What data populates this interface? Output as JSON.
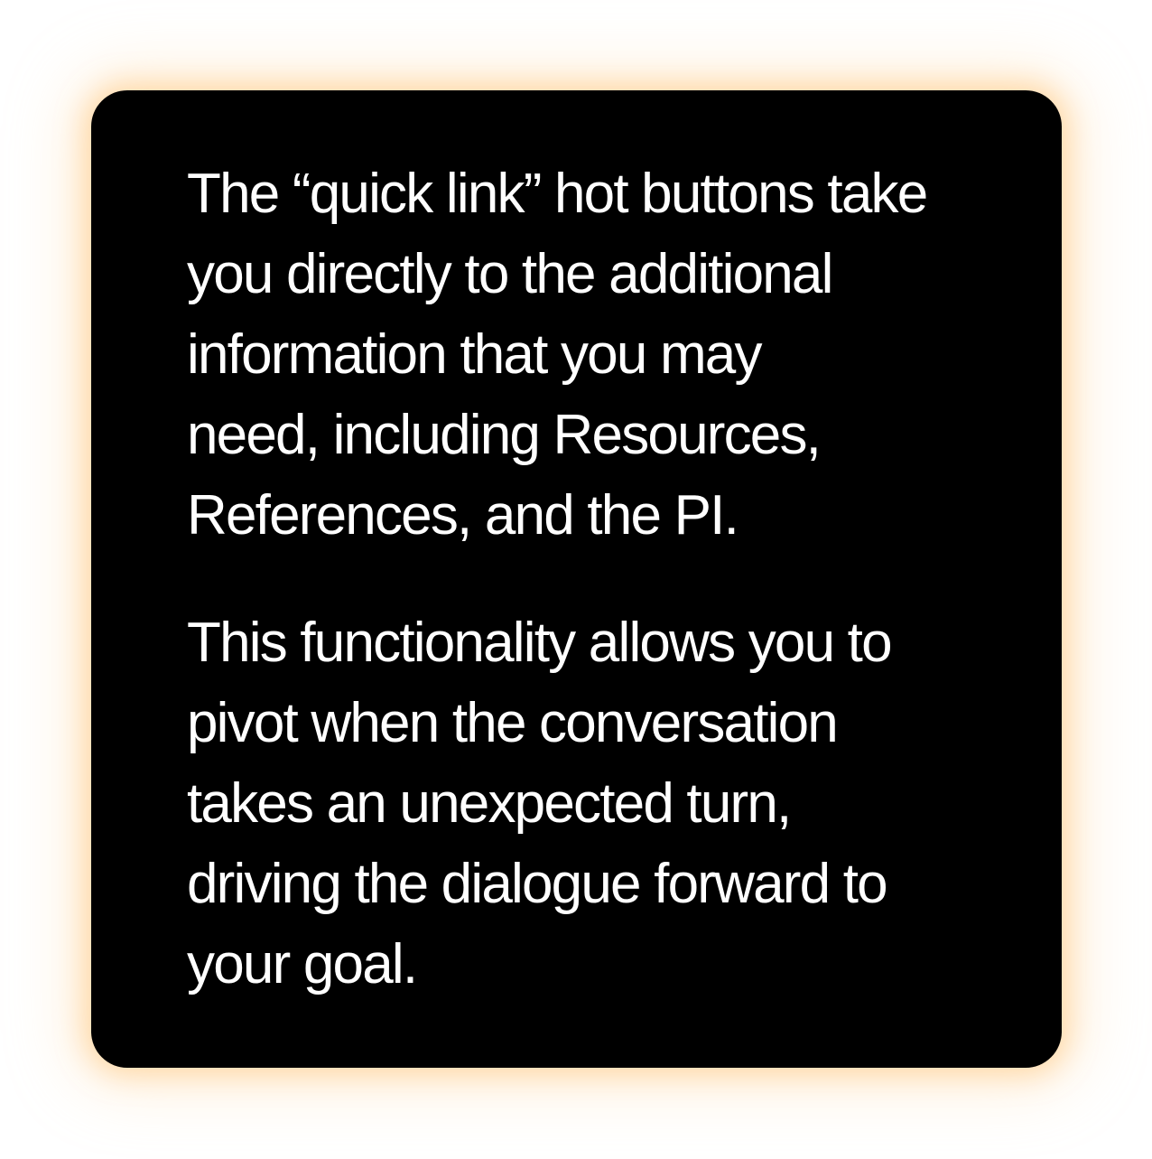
{
  "card": {
    "background": "#000000",
    "glow_color": "#FFC478",
    "paragraphs": [
      {
        "lines": [
          "The “quick link” hot buttons take",
          "you directly to the additional",
          "information that you may",
          "need, including Resources,",
          "References, and the PI."
        ]
      },
      {
        "lines": [
          "This functionality allows you to",
          "pivot when the conversation",
          "takes an unexpected turn,",
          "driving the dialogue forward to",
          "your goal."
        ]
      }
    ]
  }
}
